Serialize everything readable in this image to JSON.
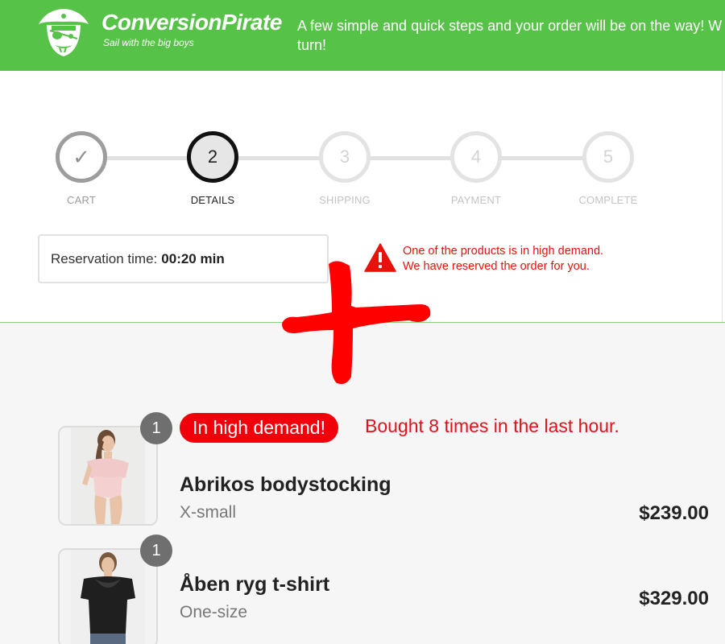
{
  "header": {
    "brand_name": "ConversionPirate",
    "tagline": "Sail with the big boys",
    "message": "A few simple and quick steps and your order will be on the way! W turn!",
    "bg_color": "#56c247"
  },
  "stepper": {
    "steps": [
      {
        "number": "✓",
        "label": "CART",
        "state": "done"
      },
      {
        "number": "2",
        "label": "DETAILS",
        "state": "active"
      },
      {
        "number": "3",
        "label": "SHIPPING",
        "state": "upcoming"
      },
      {
        "number": "4",
        "label": "PAYMENT",
        "state": "upcoming"
      },
      {
        "number": "5",
        "label": "COMPLETE",
        "state": "upcoming"
      }
    ]
  },
  "reservation": {
    "label": "Reservation time:",
    "time": "00:20 min"
  },
  "demand_notice": {
    "line1": "One of the products is in high demand.",
    "line2": "We have reserved the order for you.",
    "icon": "warning-triangle-icon",
    "color": "#e8110b"
  },
  "cart": {
    "items": [
      {
        "quantity": "1",
        "demand_badge": "In high demand!",
        "demand_text": "Bought 8 times in the last hour.",
        "name": "Abrikos bodystocking",
        "variant": "X-small",
        "price": "$239.00"
      },
      {
        "quantity": "1",
        "name": "Åben ryg t-shirt",
        "variant": "One-size",
        "price": "$329.00"
      }
    ]
  }
}
